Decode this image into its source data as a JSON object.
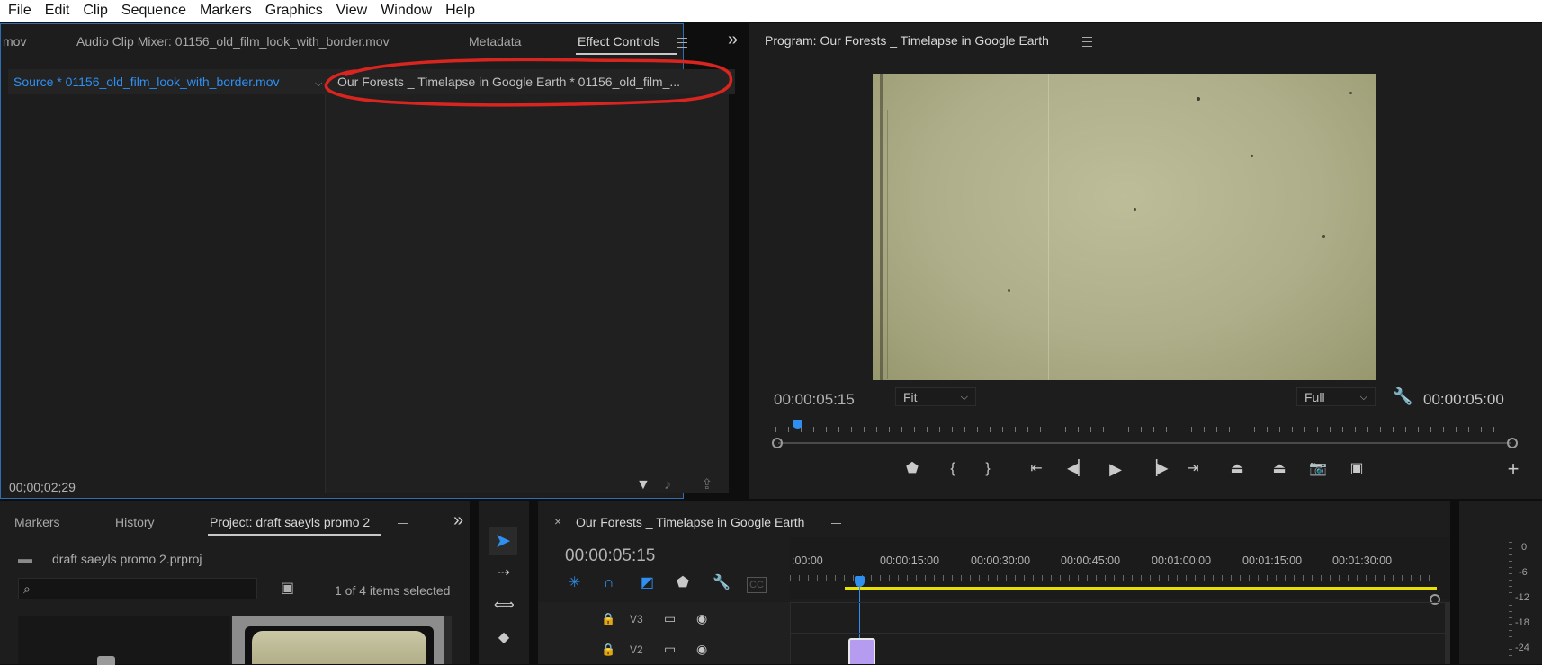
{
  "menu": [
    "File",
    "Edit",
    "Clip",
    "Sequence",
    "Markers",
    "Graphics",
    "View",
    "Window",
    "Help"
  ],
  "source_panel": {
    "tabs": {
      "partial": "mov",
      "audio_mixer": "Audio Clip Mixer: 01156_old_film_look_with_border.mov",
      "metadata": "Metadata",
      "effect_controls": "Effect Controls",
      "overflow": "»"
    },
    "source_label": "Source * 01156_old_film_look_with_border.mov",
    "sequence_label": "Our Forests _ Timelapse in Google Earth * 01156_old_film_...",
    "timecode": "00;00;02;29"
  },
  "program_monitor": {
    "title": "Program: Our Forests _ Timelapse in Google Earth",
    "current_time": "00:00:05:15",
    "fit": "Fit",
    "quality": "Full",
    "duration": "00:00:05:00",
    "playhead_fraction": 0.03
  },
  "project_panel": {
    "tabs": {
      "markers": "Markers",
      "history": "History",
      "project": "Project: draft saeyls promo 2"
    },
    "file_name": "draft saeyls promo 2.prproj",
    "items_selected": "1 of 4 items selected",
    "search_placeholder": ""
  },
  "timeline": {
    "close": "×",
    "title": "Our Forests _ Timelapse in Google Earth",
    "current_time": "00:00:05:15",
    "ruler": [
      ":00:00",
      "00:00:15:00",
      "00:00:30:00",
      "00:00:45:00",
      "00:01:00:00",
      "00:01:15:00",
      "00:01:30:00"
    ],
    "tracks": [
      "V3",
      "V2"
    ],
    "cc": "CC"
  },
  "audio_meter": {
    "levels": [
      "0",
      "-6",
      "-12",
      "-18",
      "-24"
    ]
  },
  "colors": {
    "accent": "#2f8ff0",
    "annotation": "#d9251f",
    "work_area": "#e8e000",
    "clip": "#b59cf0"
  }
}
